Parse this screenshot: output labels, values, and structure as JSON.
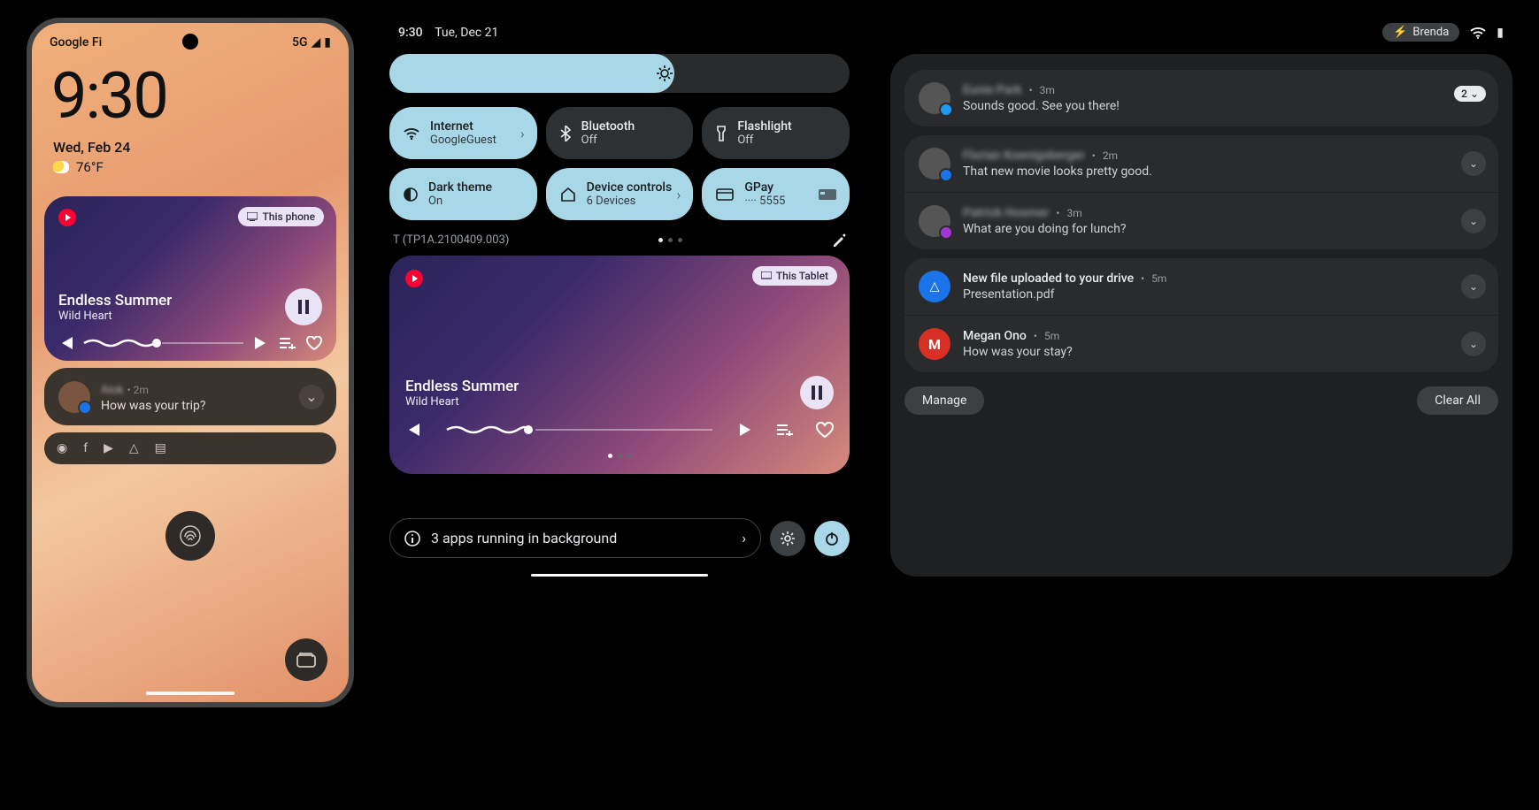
{
  "phone": {
    "carrier": "Google Fi",
    "network": "5G",
    "clock": "9:30",
    "date": "Wed, Feb 24",
    "temp": "76°F",
    "media": {
      "cast_label": "This phone",
      "title": "Endless Summer",
      "artist": "Wild Heart"
    },
    "notif": {
      "sender": "Alok",
      "time": "2m",
      "msg": "How was your trip?"
    }
  },
  "tablet": {
    "clock": "9:30",
    "date": "Tue, Dec 21",
    "user": "Brenda",
    "build": "T (TP1A.2100409.003)",
    "tiles": [
      {
        "icon": "wifi",
        "title": "Internet",
        "sub": "GoogleGuest",
        "active": true,
        "chevron": true
      },
      {
        "icon": "bluetooth",
        "title": "Bluetooth",
        "sub": "Off",
        "active": false
      },
      {
        "icon": "flashlight",
        "title": "Flashlight",
        "sub": "Off",
        "active": false
      },
      {
        "icon": "darktheme",
        "title": "Dark theme",
        "sub": "On",
        "active": true
      },
      {
        "icon": "home",
        "title": "Device controls",
        "sub": "6 Devices",
        "active": true,
        "chevron": true
      },
      {
        "icon": "card",
        "title": "GPay",
        "sub": "···· 5555",
        "active": true,
        "trailing_card": true
      }
    ],
    "media": {
      "cast_label": "This Tablet",
      "title": "Endless Summer",
      "artist": "Wild Heart"
    },
    "bg_apps": "3 apps running in background",
    "notifications": [
      {
        "sender": "Eunie Park",
        "time": "3m",
        "msg": "Sounds good. See you there!",
        "blur": true,
        "badge": "twitter",
        "count": "2"
      },
      {
        "sender": "Florian Koenigsberger",
        "time": "2m",
        "msg": "That new movie looks pretty good.",
        "blur": true,
        "badge": "messages",
        "group": 1
      },
      {
        "sender": "Patrick Hosmer",
        "time": "3m",
        "msg": "What are you doing for lunch?",
        "blur": true,
        "badge": "messenger",
        "group": 1
      },
      {
        "sender": "New file uploaded to your drive",
        "time": "5m",
        "msg": "Presentation.pdf",
        "icon": "drive",
        "group": 2
      },
      {
        "sender": "Megan Ono",
        "time": "5m",
        "msg": "How was your stay?",
        "icon": "gmail",
        "group": 2
      }
    ],
    "manage": "Manage",
    "clear": "Clear All"
  }
}
